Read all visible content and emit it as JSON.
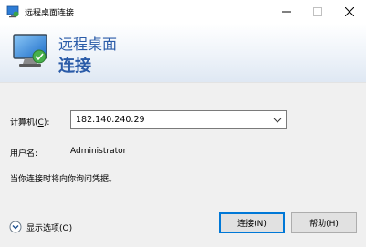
{
  "window": {
    "title": "远程桌面连接",
    "controls": {
      "minimize": "minimize",
      "maximize": "maximize",
      "close": "close"
    }
  },
  "banner": {
    "line1": "远程桌面",
    "line2": "连接",
    "icon": "remote-desktop-icon"
  },
  "form": {
    "computer_label": "计算机(",
    "computer_accel": "C",
    "computer_label_end": "):",
    "computer_value": "182.140.240.29",
    "username_label": "用户名:",
    "username_value": "Administrator",
    "credentials_note": "当你连接时将向你询问凭据。"
  },
  "footer": {
    "show_options_prefix": "显示选项(",
    "show_options_accel": "O",
    "show_options_suffix": ")",
    "connect_button": "连接(N)",
    "help_button": "帮助(H)"
  },
  "colors": {
    "accent": "#2a5ba8",
    "focus_border": "#0078d7"
  }
}
